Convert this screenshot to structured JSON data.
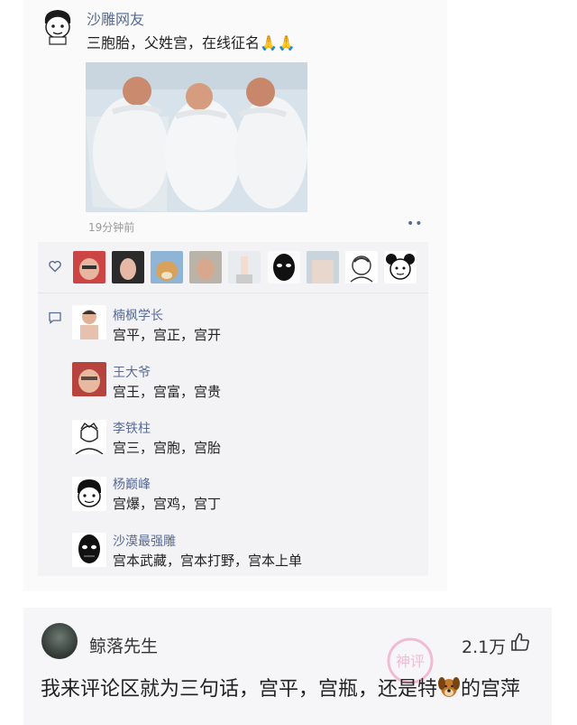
{
  "post": {
    "author": "沙雕网友",
    "text": "三胞胎，父姓宫，在线征名🙏🙏",
    "time": "19分钟前",
    "more": "••"
  },
  "likes": {
    "icon": "heart-icon",
    "avatar_count": 9
  },
  "comments": [
    {
      "name": "楠枫学长",
      "text": "宫平，宫正，宫开"
    },
    {
      "name": "王大爷",
      "text": "宫王，宫富，宫贵"
    },
    {
      "name": "李铁柱",
      "text": "宫三，宫胞，宫胎"
    },
    {
      "name": "杨巅峰",
      "text": "宫爆，宫鸡，宫丁"
    },
    {
      "name": "沙漠最强雕",
      "text": "宫本武藏，宫本打野，宫本上单"
    }
  ],
  "reply": {
    "name": "鲸落先生",
    "likes": "2.1万",
    "text_before": "我来评论区就为三句话，宫平，宫瓶，还是特",
    "text_after": "的宫萍",
    "emoji": "dog-face-icon",
    "watermark": "神评"
  },
  "colors": {
    "link": "#576b95",
    "panel": "#f3f3f5",
    "watermark": "#e94f8f"
  }
}
